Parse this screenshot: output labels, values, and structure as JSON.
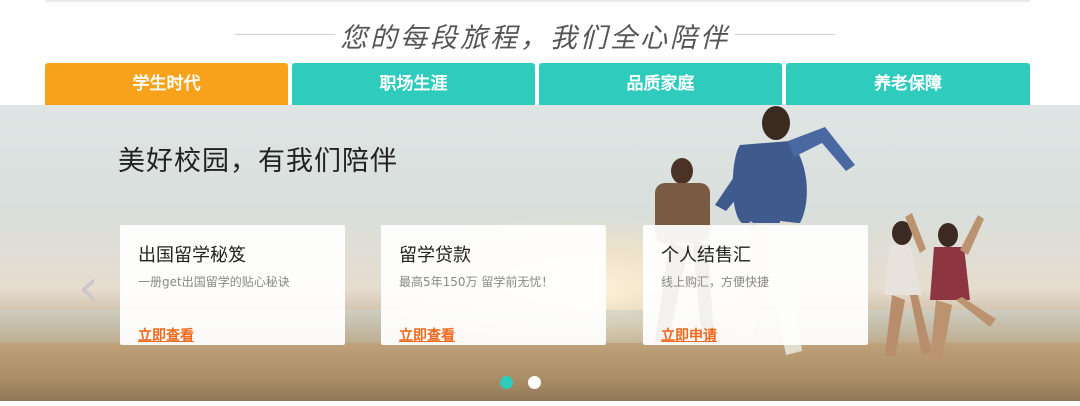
{
  "slogan": "您的每段旅程，我们全心陪伴",
  "tabs": [
    {
      "label": "学生时代",
      "active": true
    },
    {
      "label": "职场生涯",
      "active": false
    },
    {
      "label": "品质家庭",
      "active": false
    },
    {
      "label": "养老保障",
      "active": false
    }
  ],
  "hero": {
    "headline": "美好校园，有我们陪伴",
    "cards": [
      {
        "title": "出国留学秘笈",
        "desc": "一册get出国留学的贴心秘诀",
        "link": "立即查看"
      },
      {
        "title": "留学贷款",
        "desc": "最高5年150万 留学前无忧！",
        "link": "立即查看"
      },
      {
        "title": "个人结售汇",
        "desc": "线上购汇，方便快捷",
        "link": "立即申请"
      }
    ]
  },
  "carousel": {
    "current": 1,
    "total": 2
  },
  "colors": {
    "tab": "#2fcbbd",
    "tab_active": "#f7a21a",
    "link": "#f06a1d"
  }
}
